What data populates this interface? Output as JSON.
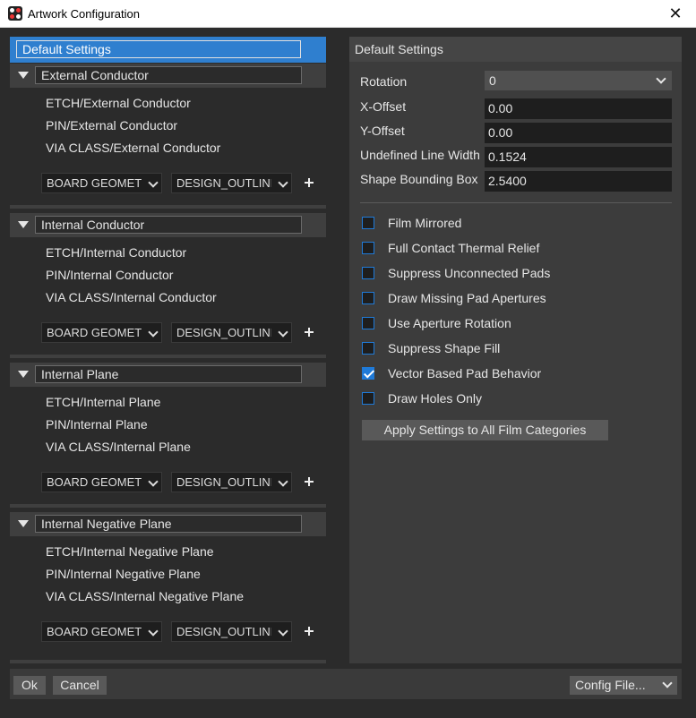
{
  "window": {
    "title": "Artwork Configuration",
    "close_glyph": "✕"
  },
  "left": {
    "root_label": "Default Settings",
    "categories": [
      {
        "label": "External Conductor",
        "items": [
          "ETCH/External Conductor",
          "PIN/External Conductor",
          "VIA CLASS/External Conductor"
        ],
        "class_combo": "BOARD GEOMETRY",
        "subclass_combo": "DESIGN_OUTLINE"
      },
      {
        "label": "Internal Conductor",
        "items": [
          "ETCH/Internal Conductor",
          "PIN/Internal Conductor",
          "VIA CLASS/Internal Conductor"
        ],
        "class_combo": "BOARD GEOMETRY",
        "subclass_combo": "DESIGN_OUTLINE"
      },
      {
        "label": "Internal Plane",
        "items": [
          "ETCH/Internal Plane",
          "PIN/Internal Plane",
          "VIA CLASS/Internal Plane"
        ],
        "class_combo": "BOARD GEOMETRY",
        "subclass_combo": "DESIGN_OUTLINE"
      },
      {
        "label": "Internal Negative Plane",
        "items": [
          "ETCH/Internal Negative Plane",
          "PIN/Internal Negative Plane",
          "VIA CLASS/Internal Negative Plane"
        ],
        "class_combo": "BOARD GEOMETRY",
        "subclass_combo": "DESIGN_OUTLINE"
      }
    ]
  },
  "right": {
    "header": "Default Settings",
    "rotation": {
      "label": "Rotation",
      "value": "0"
    },
    "x_offset": {
      "label": "X-Offset",
      "value": "0.00"
    },
    "y_offset": {
      "label": "Y-Offset",
      "value": "0.00"
    },
    "line_width": {
      "label": "Undefined Line Width",
      "value": "0.1524"
    },
    "bbox": {
      "label": "Shape Bounding Box",
      "value": "2.5400"
    },
    "checkboxes": [
      {
        "label": "Film Mirrored",
        "checked": false
      },
      {
        "label": "Full Contact Thermal Relief",
        "checked": false
      },
      {
        "label": "Suppress Unconnected Pads",
        "checked": false
      },
      {
        "label": "Draw Missing Pad Apertures",
        "checked": false
      },
      {
        "label": "Use Aperture Rotation",
        "checked": false
      },
      {
        "label": "Suppress Shape Fill",
        "checked": false
      },
      {
        "label": "Vector Based Pad Behavior",
        "checked": true
      },
      {
        "label": "Draw Holes Only",
        "checked": false
      }
    ],
    "apply_label": "Apply Settings to All Film Categories"
  },
  "footer": {
    "ok_label": "Ok",
    "cancel_label": "Cancel",
    "config_label": "Config File..."
  },
  "colors": {
    "accent": "#2f7fcf",
    "checkbox": "#1f7ad8",
    "background": "#2b2b2b"
  }
}
